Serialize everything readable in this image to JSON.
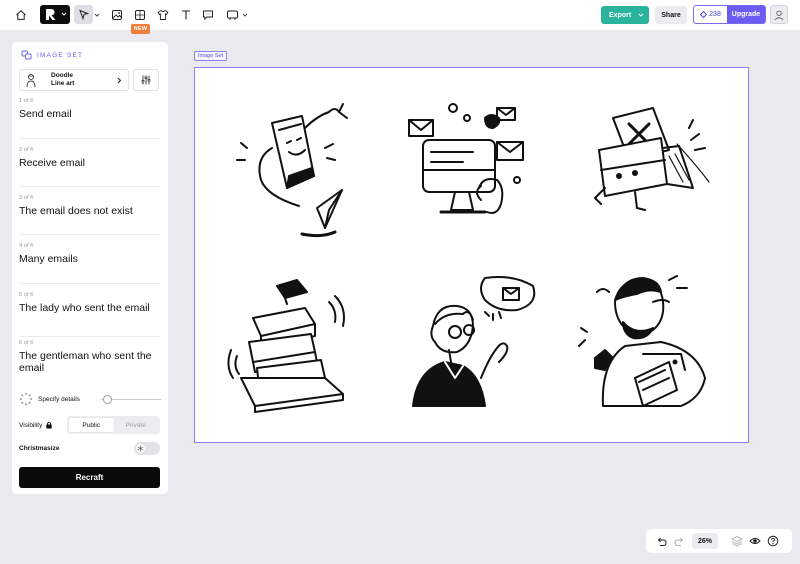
{
  "toolbar": {
    "new_badge": "NEW",
    "export_label": "Export",
    "share_label": "Share",
    "credits": "238",
    "upgrade_label": "Upgrade",
    "icons": [
      "home-icon",
      "logo-icon",
      "select-tool-icon",
      "image-icon",
      "image-set-icon",
      "mockup-icon",
      "text-tool-icon",
      "comment-icon",
      "frame-tool-icon"
    ]
  },
  "panel": {
    "header": "IMAGE SET",
    "style_name_line1": "Doodle",
    "style_name_line2": "Line art",
    "prompts": [
      {
        "index": "1 of 6",
        "text": "Send email"
      },
      {
        "index": "2 of 6",
        "text": "Receive email"
      },
      {
        "index": "3 of 6",
        "text": "The email does not exist"
      },
      {
        "index": "4 of 6",
        "text": "Many emails"
      },
      {
        "index": "5 of 6",
        "text": "The lady who sent the email"
      },
      {
        "index": "6 of 6",
        "text": "The gentleman who sent the email"
      }
    ],
    "specify_label": "Specify details",
    "visibility_label": "Visibility",
    "visibility_options": [
      "Public",
      "Private"
    ],
    "visibility_selected": "Public",
    "christmasize_label": "Christmasize",
    "christmasize_on": false,
    "recraft_label": "Recraft"
  },
  "canvas": {
    "frame_label": "Image Set",
    "illustrations": [
      "send-email-illustration",
      "receive-email-illustration",
      "email-not-exist-illustration",
      "many-emails-illustration",
      "lady-sent-email-illustration",
      "gentleman-sent-email-illustration"
    ]
  },
  "bottom": {
    "zoom": "26%",
    "icons": [
      "undo-icon",
      "redo-icon",
      "layers-icon",
      "eye-icon",
      "help-icon"
    ]
  },
  "colors": {
    "accent": "#6a5cf0",
    "export": "#2ab39d",
    "new_badge": "#f07e3b"
  }
}
